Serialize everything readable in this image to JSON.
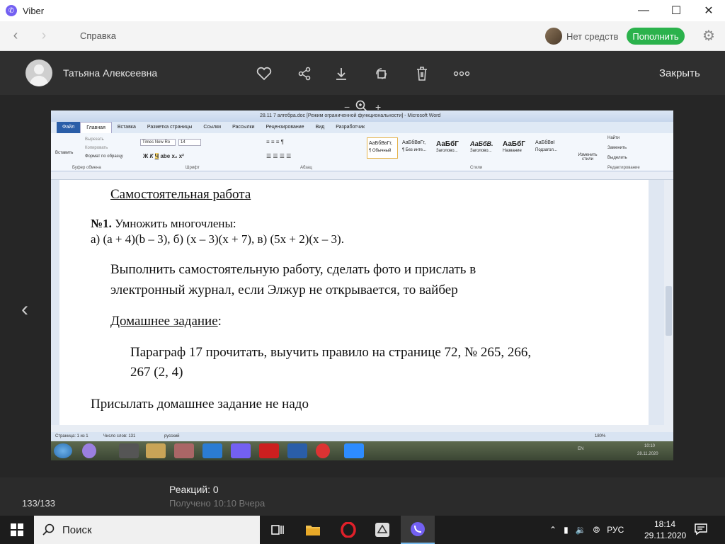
{
  "window": {
    "title": "Viber"
  },
  "nav": {
    "help": "Справка",
    "balance": "Нет средств",
    "topup": "Пополнить"
  },
  "viewer": {
    "user_name": "Татьяна Алексеевна",
    "close": "Закрыть",
    "counter": "133/133",
    "reactions": "Реакций: 0",
    "received": "Получено 10:10 Вчера"
  },
  "word": {
    "title": "28.11 7 алгебра.doc [Режим ограниченной функциональности] - Microsoft Word",
    "tabs": [
      "Файл",
      "Главная",
      "Вставка",
      "Разметка страницы",
      "Ссылки",
      "Рассылки",
      "Рецензирование",
      "Вид",
      "Разработчик"
    ],
    "font_name": "Times New Ro",
    "font_size": "14",
    "groups": [
      "Буфер обмена",
      "Шрифт",
      "Абзац",
      "Стили",
      "Редактирование"
    ],
    "clipboard": {
      "paste": "Вставить",
      "cut": "Вырезать",
      "copy": "Копировать",
      "format": "Формат по образцу"
    },
    "styles": [
      {
        "sample": "АаБбВвГг,",
        "name": "¶ Обычный"
      },
      {
        "sample": "АаБбВвГг,",
        "name": "¶ Без инте..."
      },
      {
        "sample": "АаБбГ",
        "name": "Заголово..."
      },
      {
        "sample": "АаБбВ.",
        "name": "Заголово..."
      },
      {
        "sample": "АаБбГ",
        "name": "Название"
      },
      {
        "sample": "АаБбВвІ",
        "name": "Подзагол..."
      }
    ],
    "change_styles": "Изменить стили",
    "editing": [
      "Найти",
      "Заменить",
      "Выделить"
    ],
    "status": {
      "page": "Страница: 1 из 1",
      "words": "Число слов: 131",
      "lang": "русский",
      "zoom": "180%"
    },
    "tray": {
      "lang": "EN",
      "time": "10:10",
      "date": "28.11.2020"
    }
  },
  "doc": {
    "heading": "Самостоятельная работа",
    "task_num": "№1.",
    "task_text": " Умножить многочлены:",
    "task_items": "а) (a + 4)(b – 3),   б) (x – 3)(x + 7),      в) (5x + 2)(x – 3).",
    "para1_line1": "Выполнить самостоятельную работу, сделать фото и прислать в",
    "para1_line2": "электронный журнал, если Элжур не открывается, то вайбер",
    "homework_title": "Домашнее задание",
    "homework_colon": ":",
    "homework_line1": "Параграф 17 прочитать, выучить правило на странице 72, № 265, 266,",
    "homework_line2": "267 (2, 4)",
    "final": "Присылать домашнее задание не надо"
  },
  "taskbar": {
    "search_placeholder": "Поиск",
    "lang": "РУС",
    "time": "18:14",
    "date": "29.11.2020"
  }
}
